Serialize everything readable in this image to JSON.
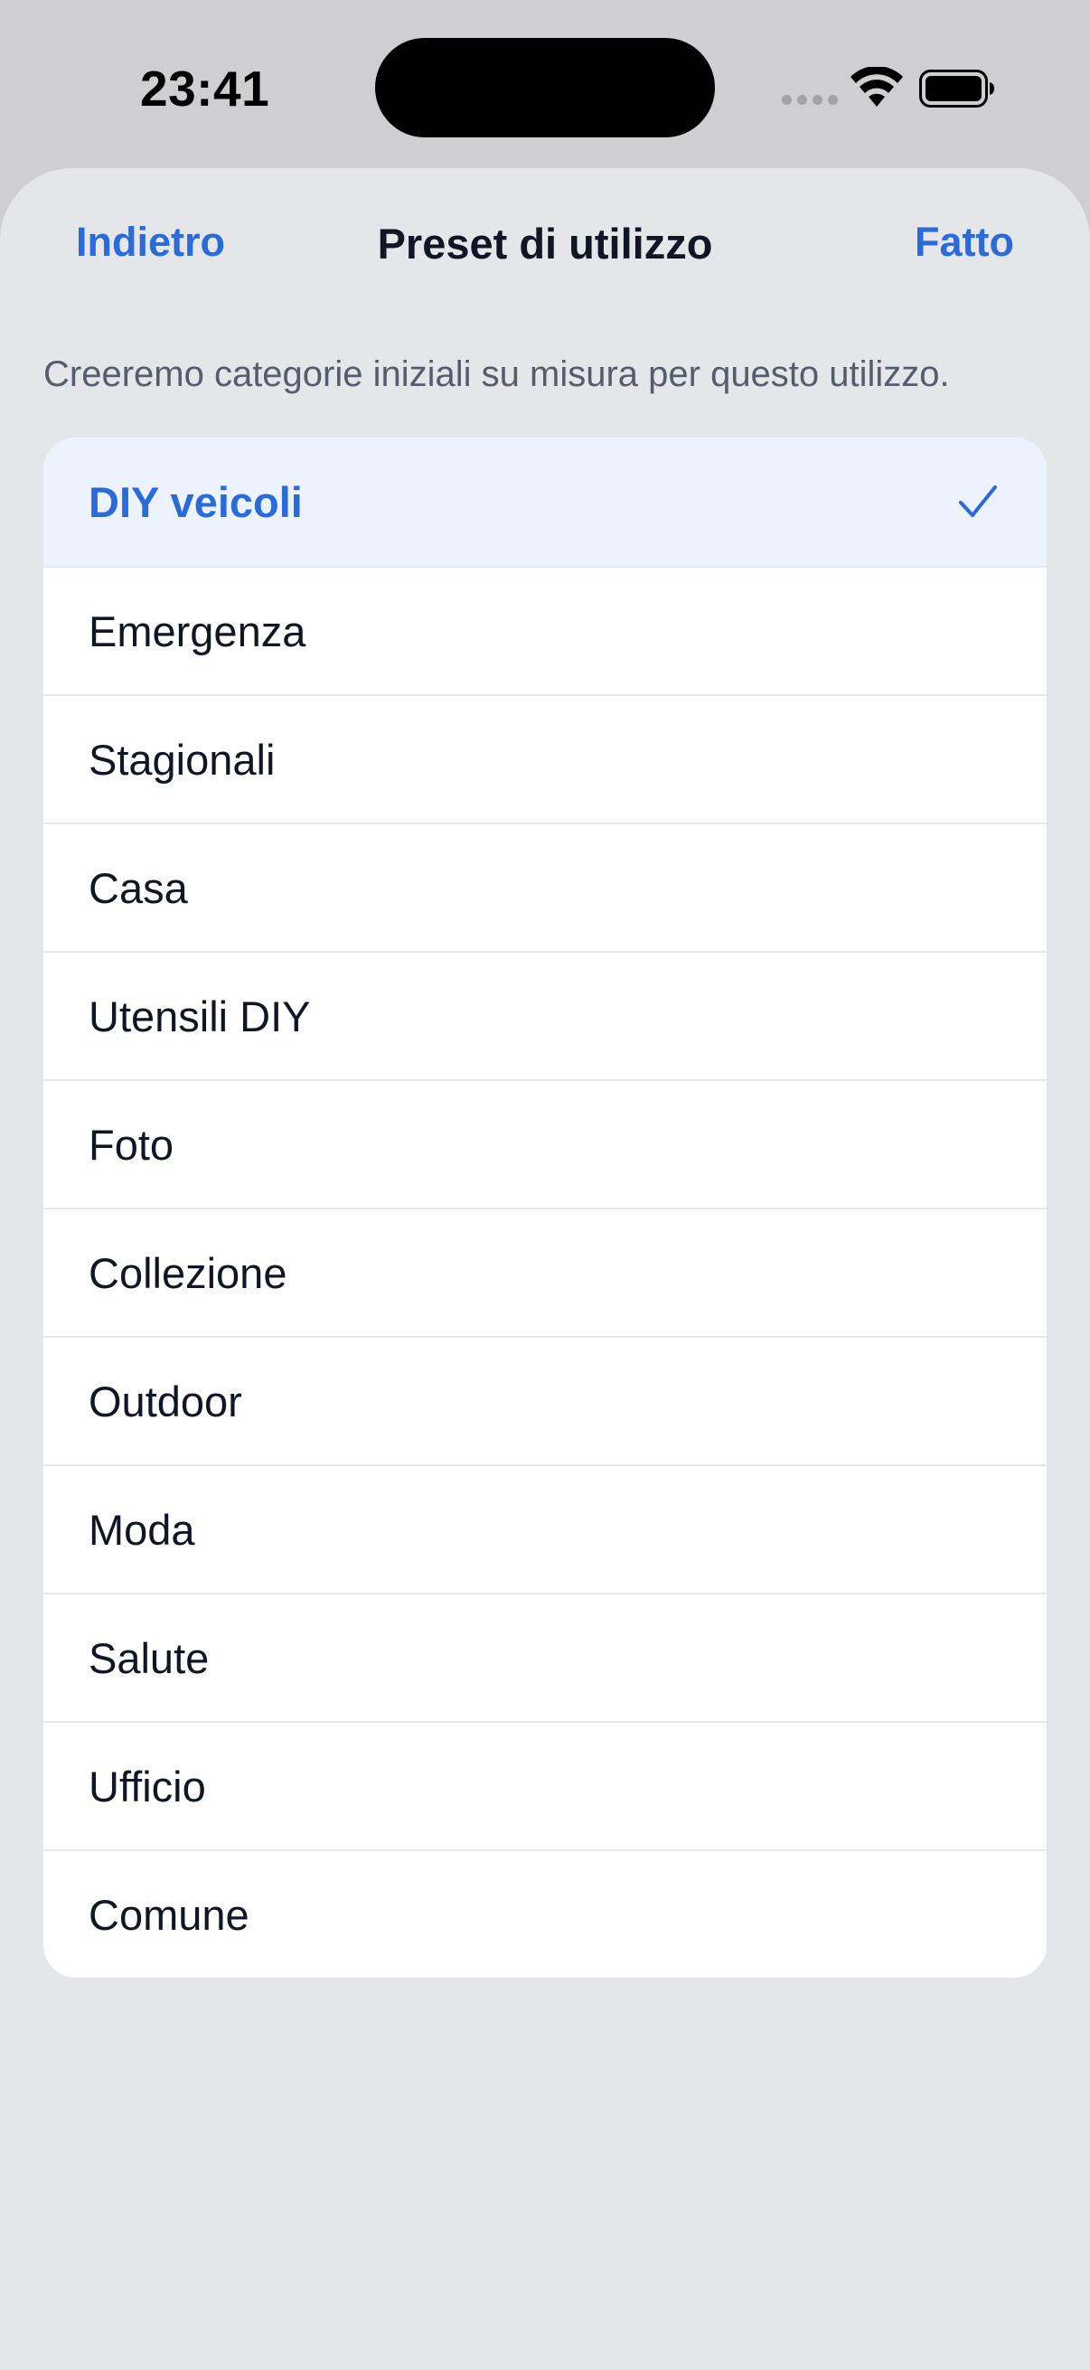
{
  "status_bar": {
    "time": "23:41"
  },
  "nav": {
    "back_label": "Indietro",
    "title": "Preset di utilizzo",
    "done_label": "Fatto"
  },
  "subtitle": "Creeremo categorie iniziali su misura per questo utilizzo.",
  "presets": [
    {
      "label": "DIY veicoli",
      "selected": true
    },
    {
      "label": "Emergenza",
      "selected": false
    },
    {
      "label": "Stagionali",
      "selected": false
    },
    {
      "label": "Casa",
      "selected": false
    },
    {
      "label": "Utensili DIY",
      "selected": false
    },
    {
      "label": "Foto",
      "selected": false
    },
    {
      "label": "Collezione",
      "selected": false
    },
    {
      "label": "Outdoor",
      "selected": false
    },
    {
      "label": "Moda",
      "selected": false
    },
    {
      "label": "Salute",
      "selected": false
    },
    {
      "label": "Ufficio",
      "selected": false
    },
    {
      "label": "Comune",
      "selected": false
    }
  ],
  "colors": {
    "accent": "#2a6ad9",
    "selected_row_bg": "#edf3fe",
    "sheet_bg": "#e5e6ea",
    "text_primary": "#111624"
  },
  "icons": {
    "selected_indicator": "checkmark-icon",
    "wifi": "wifi-icon",
    "battery": "battery-icon"
  }
}
